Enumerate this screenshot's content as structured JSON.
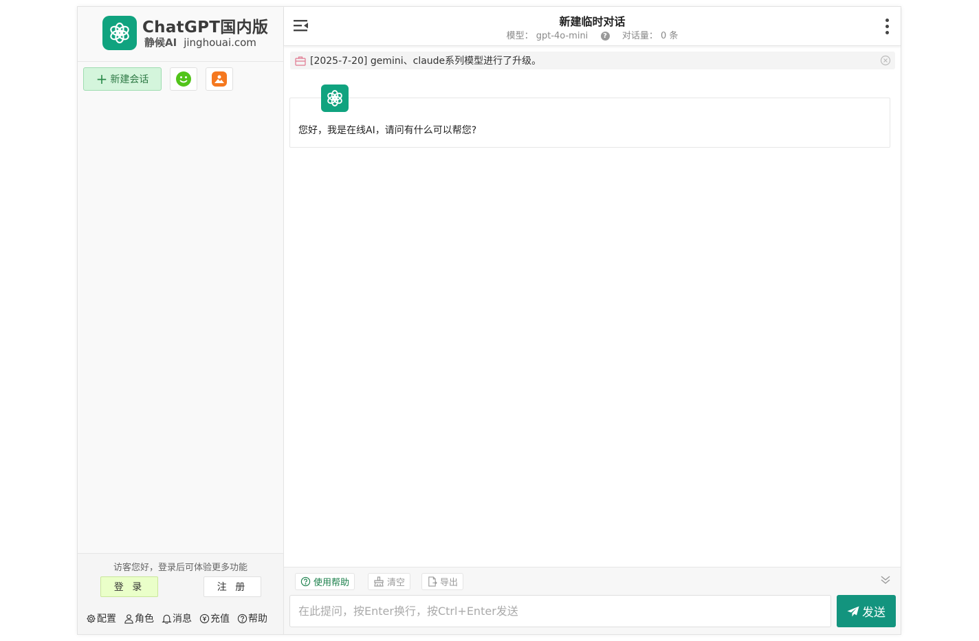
{
  "brand": {
    "title": "ChatGPT国内版",
    "sub_bold": "静候AI",
    "sub_domain": "jinghouai.com"
  },
  "sidebar": {
    "new_chat_label": "新建会话",
    "notice": "访客您好，登录后可体验更多功能",
    "login_label": "登 录",
    "register_label": "注 册",
    "footer_links": [
      {
        "label": "配置",
        "icon": "gear-icon"
      },
      {
        "label": "角色",
        "icon": "user-icon"
      },
      {
        "label": "消息",
        "icon": "bell-icon"
      },
      {
        "label": "充值",
        "icon": "coin-icon"
      },
      {
        "label": "帮助",
        "icon": "help-icon"
      }
    ]
  },
  "header": {
    "title": "新建临时对话",
    "model_label": "模型：",
    "model_value": "gpt-4o-mini",
    "count_label": "对话量：",
    "count_value": "0 条"
  },
  "announcement": {
    "text": "[2025-7-20] gemini、claude系列模型进行了升级。"
  },
  "messages": [
    {
      "role": "assistant",
      "text": "您好，我是在线AI，请问有什么可以帮您?"
    }
  ],
  "toolbar": {
    "help_label": "使用帮助",
    "clear_label": "清空",
    "export_label": "导出"
  },
  "input": {
    "placeholder": "在此提问，按Enter换行，按Ctrl+Enter发送",
    "value": ""
  },
  "send_label": "发送",
  "colors": {
    "accent": "#10a37f",
    "send": "#13947e",
    "new_chat_bg": "#d4f5dc",
    "login_bg": "#eaffc9"
  }
}
